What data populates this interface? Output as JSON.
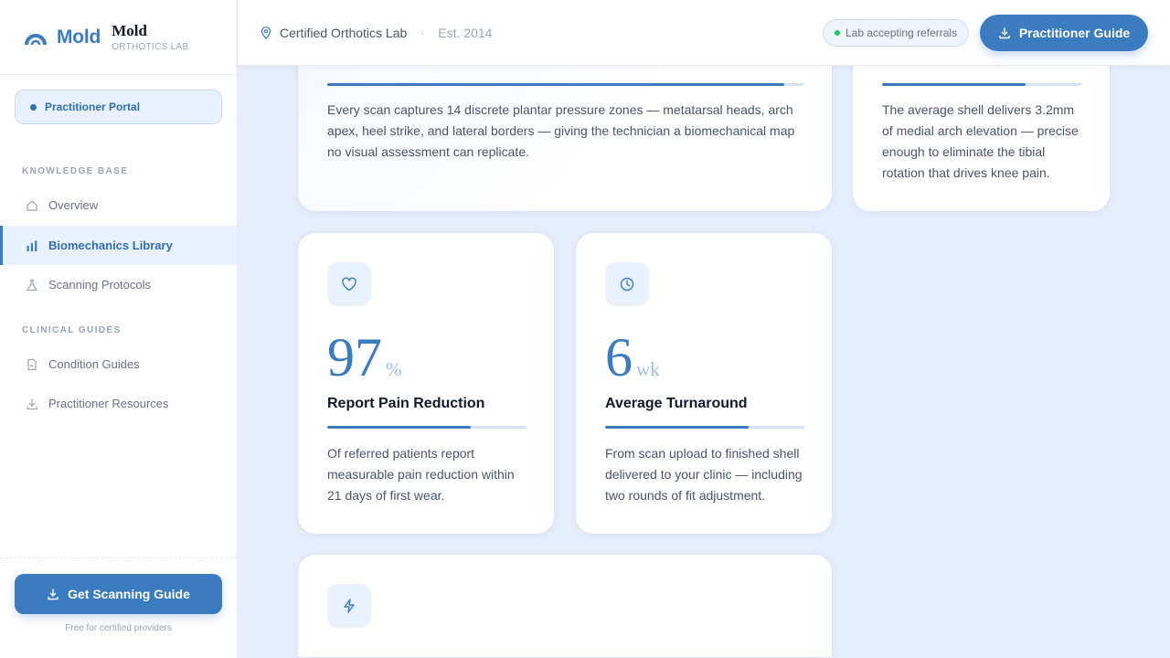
{
  "brand": {
    "logo_text": "Mold",
    "title": "Mold",
    "subtitle": "ORTHOTICS LAB"
  },
  "portal": {
    "label": "Practitioner Portal"
  },
  "sidebar": {
    "sections": [
      {
        "label": "KNOWLEDGE BASE",
        "items": [
          {
            "label": "Overview",
            "icon": "home-icon",
            "active": false
          },
          {
            "label": "Biomechanics Library",
            "icon": "bar-chart-icon",
            "active": true
          },
          {
            "label": "Scanning Protocols",
            "icon": "flask-icon",
            "active": false
          }
        ]
      },
      {
        "label": "CLINICAL GUIDES",
        "items": [
          {
            "label": "Condition Guides",
            "icon": "document-icon",
            "active": false
          },
          {
            "label": "Practitioner Resources",
            "icon": "download-icon",
            "active": false
          }
        ]
      }
    ],
    "cta_label": "Get Scanning Guide",
    "cta_note": "Free for certified providers"
  },
  "topbar": {
    "location": "Certified Orthotics Lab",
    "separator": "·",
    "established": "Est. 2014",
    "status": "Lab accepting referrals",
    "guide_button": "Practitioner Guide"
  },
  "cards": {
    "pressure": {
      "body": "Every scan captures 14 discrete plantar pressure zones — metatarsal heads, arch apex, heel strike, and lateral borders — giving the technician a biomechanical map no visual assessment can replicate.",
      "progress": 0.96
    },
    "arch": {
      "body": "The average shell delivers 3.2mm of medial arch elevation — precise enough to eliminate the tibial rotation that drives knee pain.",
      "progress": 0.72
    },
    "pain": {
      "value": "97",
      "unit": "%",
      "title": "Report Pain Reduction",
      "body": "Of referred patients report measurable pain reduction within 21 days of first wear.",
      "progress": 0.72,
      "icon": "heart-icon"
    },
    "turnaround": {
      "value": "6",
      "unit": "wk",
      "title": "Average Turnaround",
      "body": "From scan upload to finished shell delivered to your clinic — including two rounds of fit adjustment.",
      "progress": 0.72,
      "icon": "clock-icon"
    },
    "next": {
      "icon": "lightning-icon"
    }
  },
  "colors": {
    "accent": "#3b7bbf",
    "background": "#e6eefa",
    "status_dot": "#22c55e"
  }
}
